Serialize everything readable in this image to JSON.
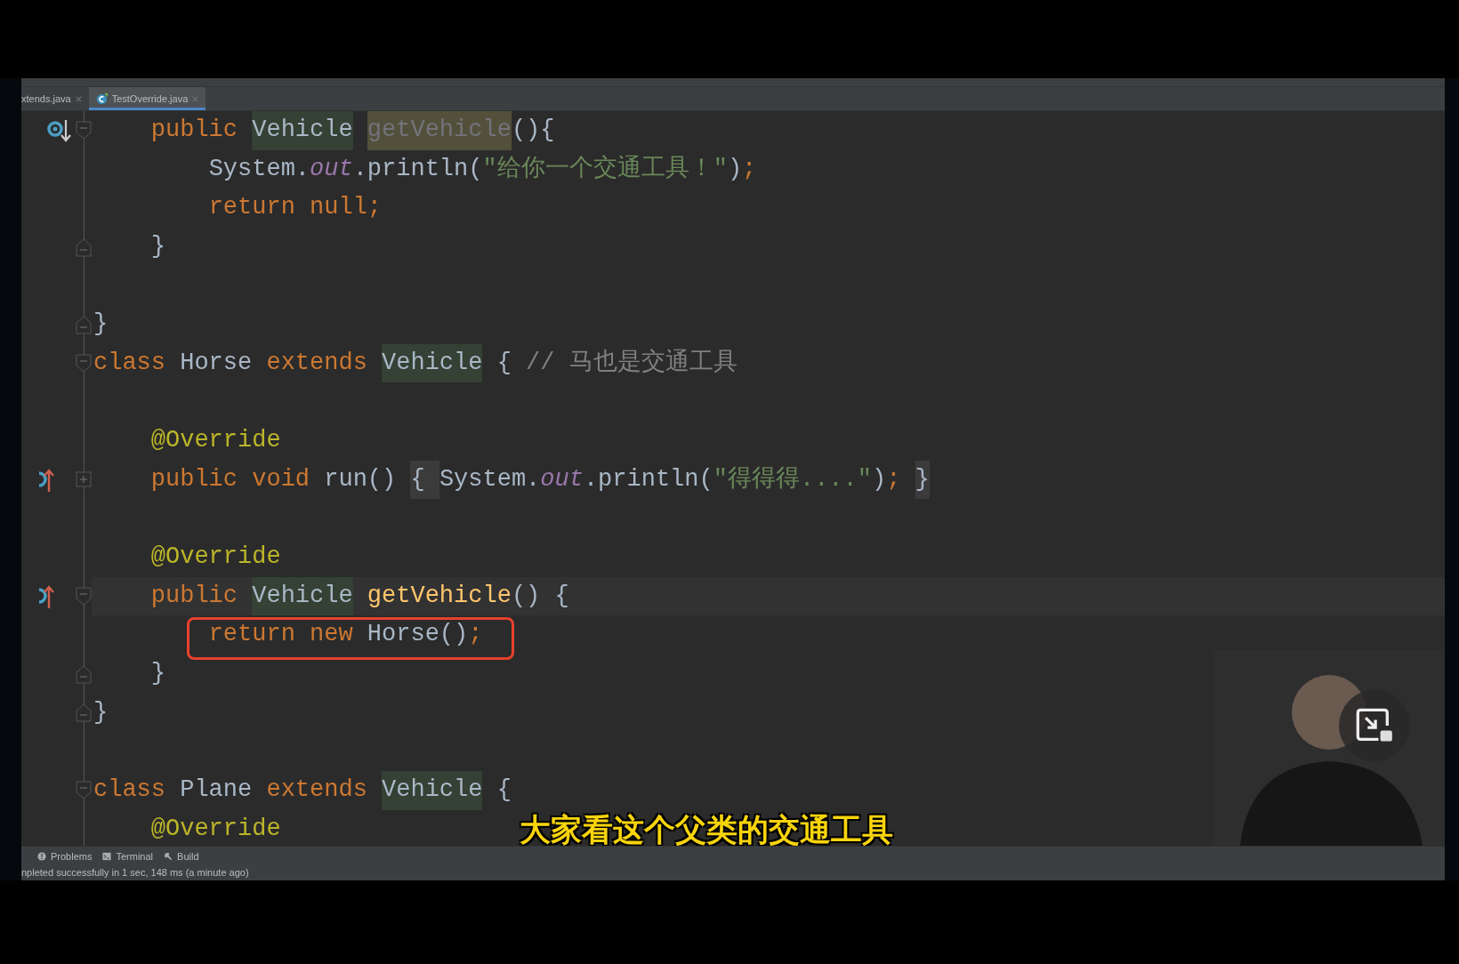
{
  "tabs": [
    {
      "label": "xtends.java",
      "selected": false
    },
    {
      "label": "TestOverride.java",
      "selected": true
    }
  ],
  "editor": {
    "lines": [
      {
        "kind": "code",
        "gutter": {
          "kind": "overridden"
        },
        "fold": {
          "kind": "start"
        },
        "tokens": [
          {
            "text": "    public",
            "kind": "keyword"
          },
          {
            "text": " Vehicle",
            "kind": "type-ref"
          },
          {
            "text": " getVehicle",
            "kind": "unused"
          },
          {
            "text": "(){",
            "kind": "plain"
          }
        ]
      },
      {
        "kind": "code",
        "tokens": [
          {
            "text": "        System.",
            "kind": "plain"
          },
          {
            "text": "out",
            "kind": "field"
          },
          {
            "text": ".println(",
            "kind": "plain"
          },
          {
            "text": "\"给你一个交通工具！\"",
            "kind": "string"
          },
          {
            "text": ")",
            "kind": "plain"
          },
          {
            "text": ";",
            "kind": "keyword"
          }
        ]
      },
      {
        "kind": "code",
        "tokens": [
          {
            "text": "        return null;",
            "kind": "keyword"
          }
        ]
      },
      {
        "kind": "code",
        "fold": {
          "kind": "end"
        },
        "tokens": [
          {
            "text": "    }",
            "kind": "plain"
          }
        ]
      },
      {
        "kind": "blank"
      },
      {
        "kind": "code",
        "fold": {
          "kind": "end"
        },
        "tokens": [
          {
            "text": "}",
            "kind": "plain"
          }
        ]
      },
      {
        "kind": "code",
        "fold": {
          "kind": "start"
        },
        "tokens": [
          {
            "text": "class",
            "kind": "keyword"
          },
          {
            "text": " Horse",
            "kind": "plain"
          },
          {
            "text": " extends",
            "kind": "keyword"
          },
          {
            "text": " Vehicle",
            "kind": "type-ref"
          },
          {
            "text": " {",
            "kind": "plain"
          },
          {
            "text": " // 马也是交通工具",
            "kind": "comment"
          }
        ]
      },
      {
        "kind": "blank"
      },
      {
        "kind": "code",
        "tokens": [
          {
            "text": "    @Override",
            "kind": "annotation"
          }
        ]
      },
      {
        "kind": "code",
        "gutter": {
          "kind": "overriding"
        },
        "fold": {
          "kind": "collapsed"
        },
        "tokens": [
          {
            "text": "    public void",
            "kind": "keyword"
          },
          {
            "text": " run()",
            "kind": "plain"
          },
          {
            "text": " { ",
            "kind": "folded"
          },
          {
            "text": "System.",
            "kind": "plain"
          },
          {
            "text": "out",
            "kind": "field"
          },
          {
            "text": ".println(",
            "kind": "plain"
          },
          {
            "text": "\"得得得....\"",
            "kind": "string"
          },
          {
            "text": ")",
            "kind": "plain"
          },
          {
            "text": ";",
            "kind": "keyword"
          },
          {
            "text": " }",
            "kind": "folded"
          }
        ]
      },
      {
        "kind": "blank"
      },
      {
        "kind": "code",
        "tokens": [
          {
            "text": "    @Override",
            "kind": "annotation"
          }
        ]
      },
      {
        "kind": "code",
        "gutter": {
          "kind": "overriding"
        },
        "fold": {
          "kind": "start"
        },
        "current": true,
        "tokens": [
          {
            "text": "    public",
            "kind": "keyword"
          },
          {
            "text": " Vehicle",
            "kind": "type-ref"
          },
          {
            "text": " getVehicle",
            "kind": "method"
          },
          {
            "text": "() {",
            "kind": "plain"
          }
        ]
      },
      {
        "kind": "code",
        "boxed": true,
        "tokens": [
          {
            "text": "        return new",
            "kind": "keyword"
          },
          {
            "text": " Horse()",
            "kind": "plain"
          },
          {
            "text": ";",
            "kind": "keyword"
          }
        ]
      },
      {
        "kind": "code",
        "fold": {
          "kind": "end"
        },
        "tokens": [
          {
            "text": "    }",
            "kind": "plain"
          }
        ]
      },
      {
        "kind": "code",
        "fold": {
          "kind": "end"
        },
        "tokens": [
          {
            "text": "}",
            "kind": "plain"
          }
        ]
      },
      {
        "kind": "blank"
      },
      {
        "kind": "code",
        "fold": {
          "kind": "start"
        },
        "tokens": [
          {
            "text": "class",
            "kind": "keyword"
          },
          {
            "text": " Plane",
            "kind": "plain"
          },
          {
            "text": " extends",
            "kind": "keyword"
          },
          {
            "text": " Vehicle",
            "kind": "type-ref"
          },
          {
            "text": " {",
            "kind": "plain"
          }
        ]
      },
      {
        "kind": "code",
        "tokens": [
          {
            "text": "    @Override",
            "kind": "annotation"
          }
        ]
      }
    ]
  },
  "tool_tabs": [
    {
      "label": "Problems",
      "kind": "problems"
    },
    {
      "label": "Terminal",
      "kind": "terminal"
    },
    {
      "label": "Build",
      "kind": "build"
    }
  ],
  "status_bar": "npleted successfully in 1 sec, 148 ms (a minute ago)",
  "subtitle": "大家看这个父类的交通工具"
}
